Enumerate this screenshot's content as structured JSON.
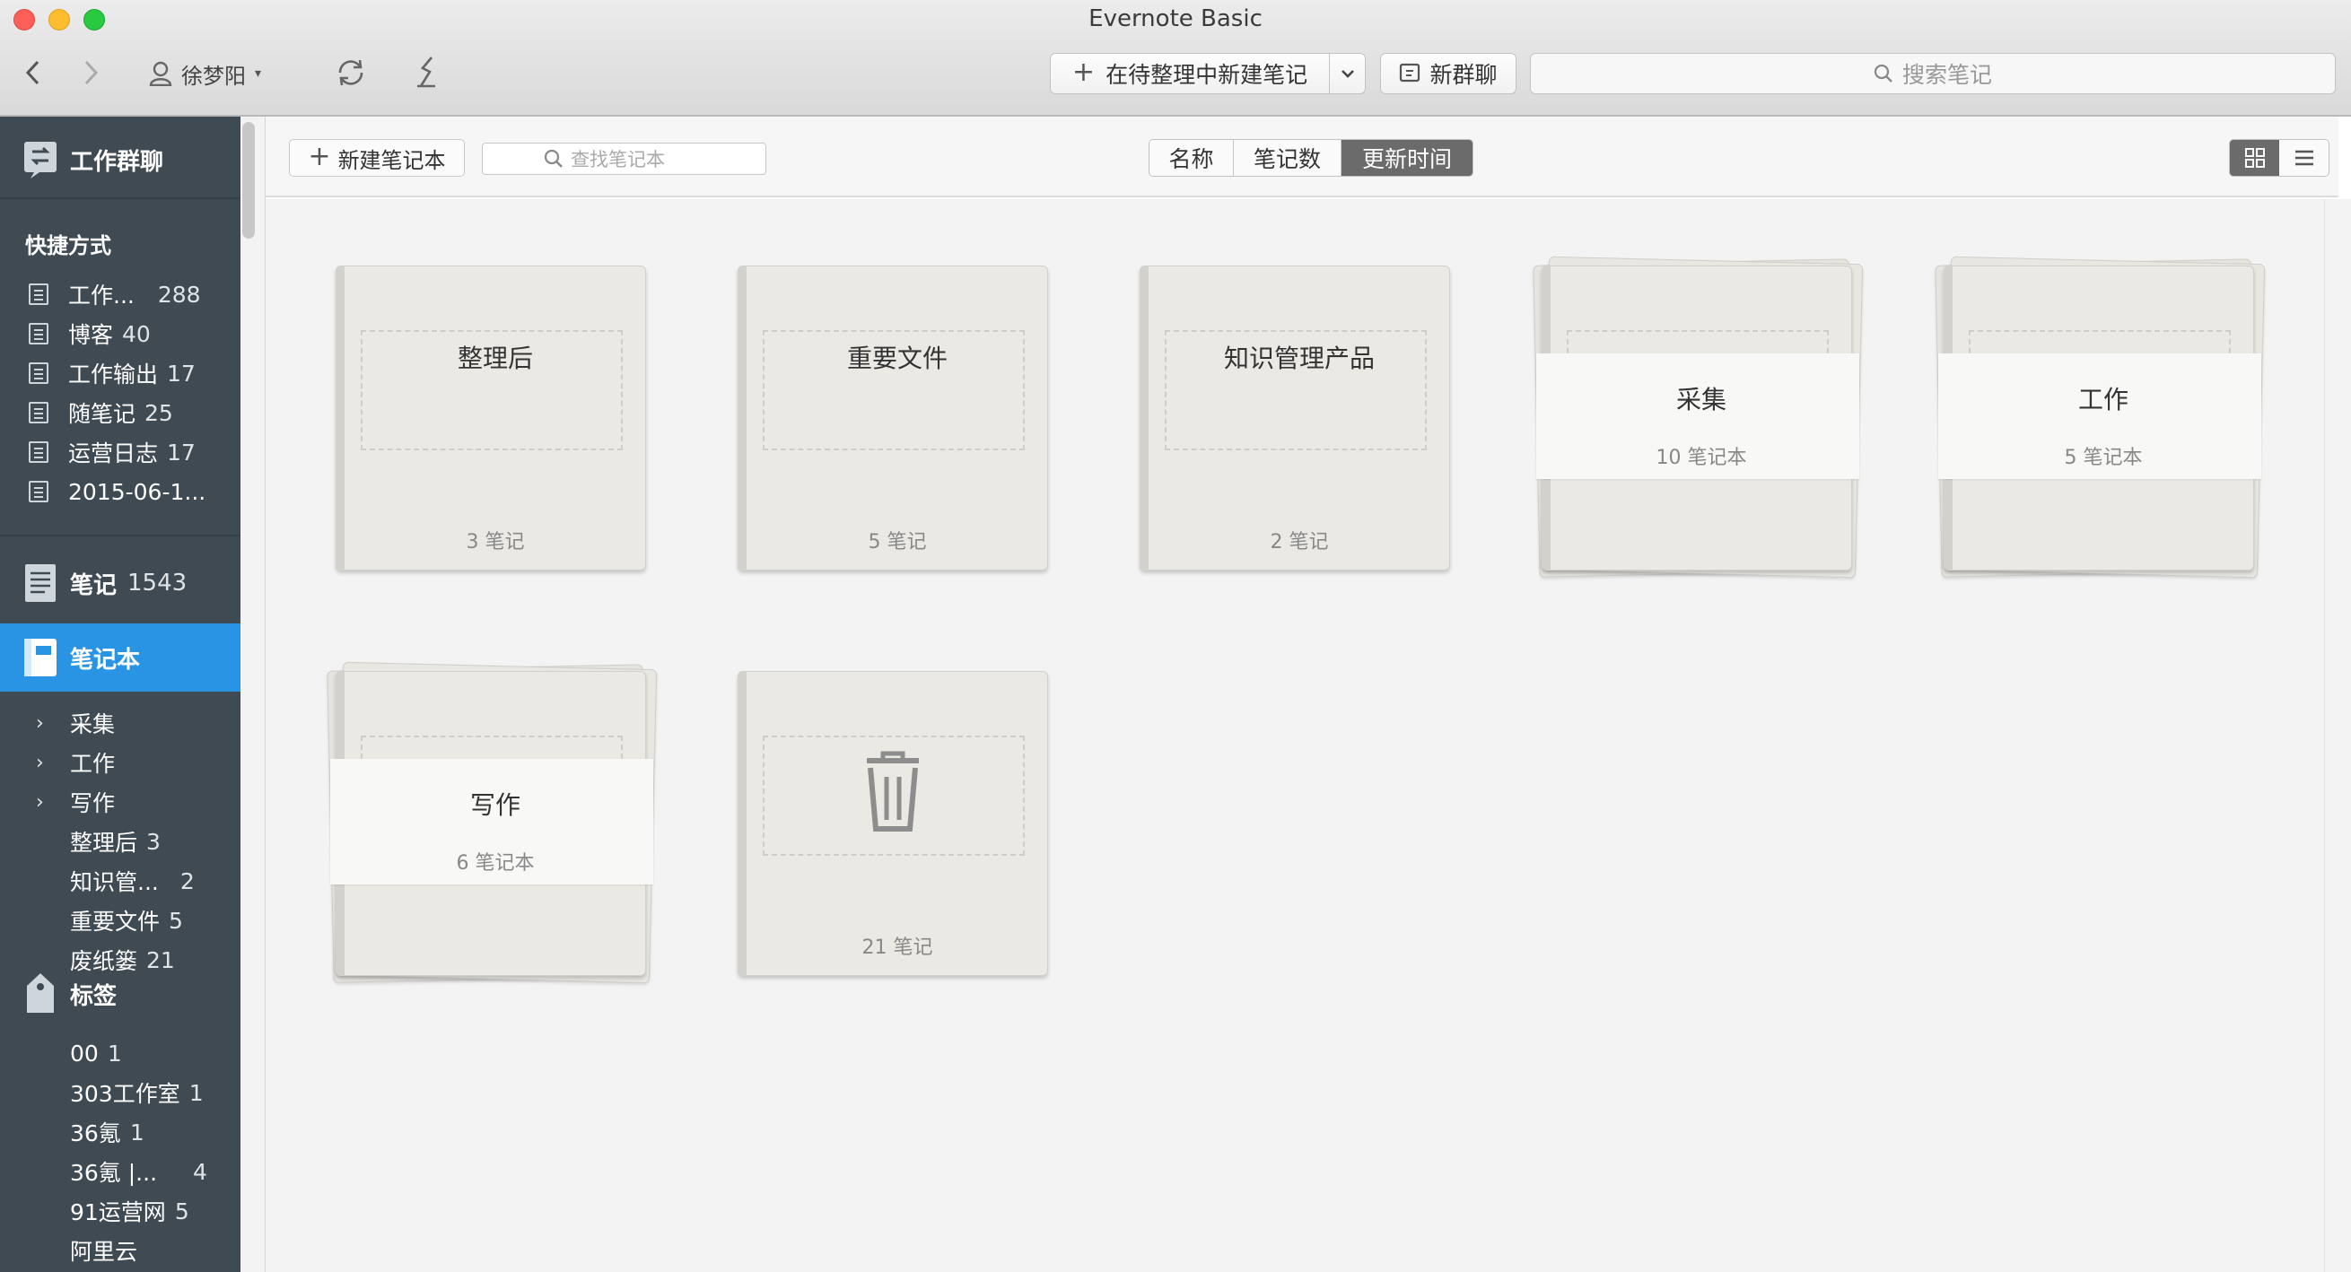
{
  "window": {
    "title": "Evernote Basic"
  },
  "toolbar": {
    "user_name": "徐梦阳",
    "new_note_label": "在待整理中新建笔记",
    "new_chat_label": "新群聊",
    "search_placeholder": "搜索笔记"
  },
  "sidebar": {
    "work_chat": "工作群聊",
    "shortcuts_label": "快捷方式",
    "shortcuts": [
      {
        "label": "工作...",
        "count": "288"
      },
      {
        "label": "博客",
        "count": "40"
      },
      {
        "label": "工作输出",
        "count": "17"
      },
      {
        "label": "随笔记",
        "count": "25"
      },
      {
        "label": "运营日志",
        "count": "17"
      },
      {
        "label": "2015-06-1...",
        "count": ""
      }
    ],
    "notes": {
      "label": "笔记",
      "count": "1543"
    },
    "notebooks": {
      "label": "笔记本"
    },
    "notebook_stacks": [
      {
        "label": "采集"
      },
      {
        "label": "工作"
      },
      {
        "label": "写作"
      }
    ],
    "notebook_items": [
      {
        "label": "整理后",
        "count": "3"
      },
      {
        "label": "知识管...",
        "count": "2"
      },
      {
        "label": "重要文件",
        "count": "5"
      },
      {
        "label": "废纸篓",
        "count": "21"
      }
    ],
    "tags": {
      "label": "标签"
    },
    "tag_items": [
      {
        "label": "00",
        "count": "1"
      },
      {
        "label": "303工作室",
        "count": "1"
      },
      {
        "label": "36氪",
        "count": "1"
      },
      {
        "label": "36氪 |...",
        "count": "4"
      },
      {
        "label": "91运营网",
        "count": "5"
      },
      {
        "label": "阿里云",
        "count": ""
      }
    ]
  },
  "notebook_toolbar": {
    "new_notebook_label": "新建笔记本",
    "find_placeholder": "查找笔记本",
    "sort": {
      "name": "名称",
      "count": "笔记数",
      "updated": "更新时间",
      "active": "更新时间"
    },
    "view_active": "grid"
  },
  "notebooks_grid": [
    {
      "name": "整理后",
      "count": "3 笔记",
      "type": "notebook"
    },
    {
      "name": "重要文件",
      "count": "5 笔记",
      "type": "notebook"
    },
    {
      "name": "知识管理产品",
      "count": "2 笔记",
      "type": "notebook"
    },
    {
      "name": "采集",
      "count": "10 笔记本",
      "type": "stack"
    },
    {
      "name": "工作",
      "count": "5 笔记本",
      "type": "stack"
    },
    {
      "name": "写作",
      "count": "6 笔记本",
      "type": "stack"
    },
    {
      "name": "",
      "count": "21 笔记",
      "type": "trash",
      "icon": "trash-icon"
    }
  ],
  "colors": {
    "sidebar_bg": "#3f4a52",
    "selected": "#2a94e4",
    "sort_active": "#6b6b6b"
  }
}
